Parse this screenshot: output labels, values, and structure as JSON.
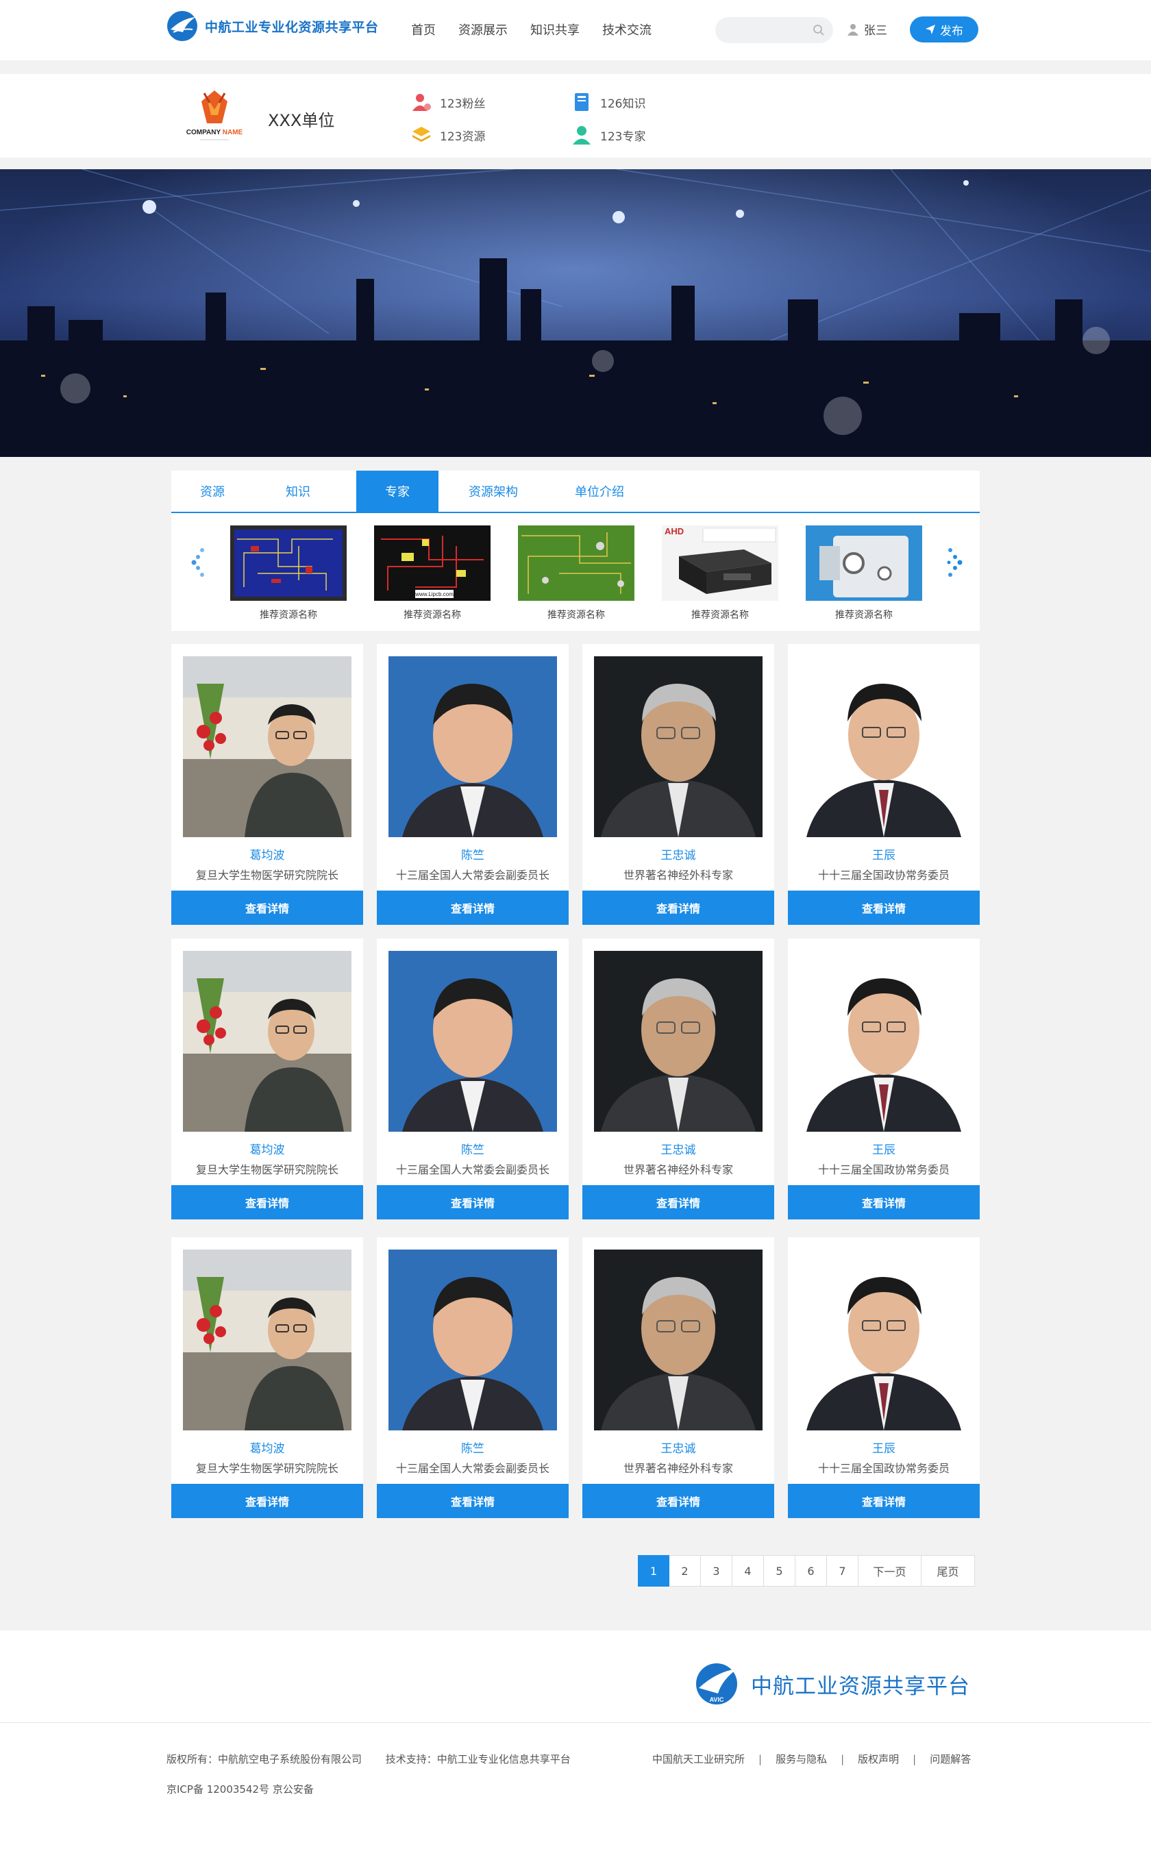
{
  "header": {
    "site_title": "中航工业专业化资源共享平台",
    "nav": [
      "首页",
      "资源展示",
      "知识共享",
      "技术交流"
    ],
    "search_placeholder": "",
    "user_name": "张三",
    "publish_label": "发布",
    "brand_color": "#1a8be6"
  },
  "org": {
    "logo_text": "COMPANY NAME",
    "name": "XXX单位",
    "stats": {
      "fans": "123粉丝",
      "resources": "123资源",
      "knowledge": "126知识",
      "experts": "123专家"
    }
  },
  "tabs": [
    {
      "label": "资源",
      "active": false
    },
    {
      "label": "知识",
      "active": false
    },
    {
      "label": "专家",
      "active": true
    },
    {
      "label": "资源架构",
      "active": false
    },
    {
      "label": "单位介绍",
      "active": false
    }
  ],
  "carousel": {
    "items": [
      {
        "caption": "推荐资源名称"
      },
      {
        "caption": "推荐资源名称",
        "overlay_text": "www.Lipcb.com"
      },
      {
        "caption": "推荐资源名称"
      },
      {
        "caption": "推荐资源名称",
        "overlay_text": "AHD"
      },
      {
        "caption": "推荐资源名称"
      }
    ]
  },
  "experts": [
    {
      "name": "葛均波",
      "title": "复旦大学生物医学研究院院长",
      "button": "查看详情"
    },
    {
      "name": "陈竺",
      "title": "十三届全国人大常委会副委员长",
      "button": "查看详情"
    },
    {
      "name": "王忠诚",
      "title": "世界著名神经外科专家",
      "button": "查看详情"
    },
    {
      "name": "王辰",
      "title": "十十三届全国政协常务委员",
      "button": "查看详情"
    },
    {
      "name": "葛均波",
      "title": "复旦大学生物医学研究院院长",
      "button": "查看详情"
    },
    {
      "name": "陈竺",
      "title": "十三届全国人大常委会副委员长",
      "button": "查看详情"
    },
    {
      "name": "王忠诚",
      "title": "世界著名神经外科专家",
      "button": "查看详情"
    },
    {
      "name": "王辰",
      "title": "十十三届全国政协常务委员",
      "button": "查看详情"
    },
    {
      "name": "葛均波",
      "title": "复旦大学生物医学研究院院长",
      "button": "查看详情"
    },
    {
      "name": "陈竺",
      "title": "十三届全国人大常委会副委员长",
      "button": "查看详情"
    },
    {
      "name": "王忠诚",
      "title": "世界著名神经外科专家",
      "button": "查看详情"
    },
    {
      "name": "王辰",
      "title": "十十三届全国政协常务委员",
      "button": "查看详情"
    }
  ],
  "pagination": {
    "pages": [
      "1",
      "2",
      "3",
      "4",
      "5",
      "6",
      "7"
    ],
    "current": "1",
    "next": "下一页",
    "last": "尾页"
  },
  "footer": {
    "brand": "中航工业资源共享平台",
    "logo_sub": "AVIC",
    "copyright": "版权所有：中航航空电子系统股份有限公司",
    "support": "技术支持：中航工业专业化信息共享平台",
    "icp": "京ICP备 12003542号 京公安备",
    "links": [
      "中国航天工业研究所",
      "服务与隐私",
      "版权声明",
      "问题解答"
    ]
  }
}
